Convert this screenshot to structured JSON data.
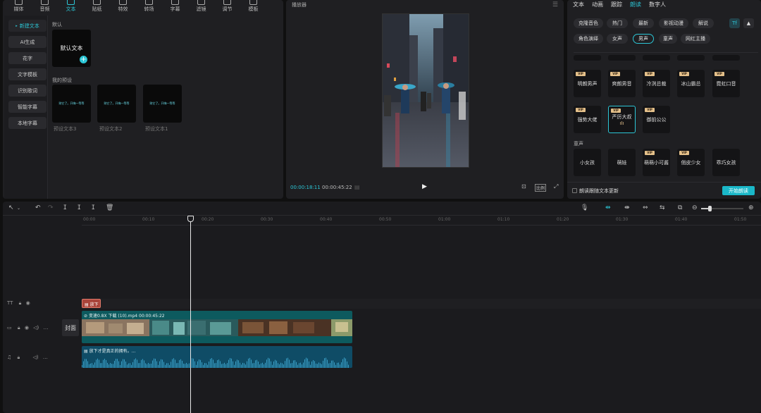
{
  "toolbar": [
    {
      "label": "媒体"
    },
    {
      "label": "音频"
    },
    {
      "label": "文本",
      "active": true
    },
    {
      "label": "贴纸"
    },
    {
      "label": "特效"
    },
    {
      "label": "转场"
    },
    {
      "label": "字幕"
    },
    {
      "label": "滤镜"
    },
    {
      "label": "调节"
    },
    {
      "label": "模板"
    }
  ],
  "sidenav": [
    {
      "label": "新建文本",
      "active": true
    },
    {
      "label": "AI生成"
    },
    {
      "label": "花字"
    },
    {
      "label": "文字模板"
    },
    {
      "label": "识别歌词"
    },
    {
      "label": "智能字幕"
    },
    {
      "label": "本地字幕"
    }
  ],
  "text_panel": {
    "default_label": "默认",
    "default_card": "默认文本",
    "add_icon": "+",
    "my_presets_label": "我的预设",
    "preset_card_text": "财它了。开嗨—等等",
    "presets": [
      "预设文本3",
      "预设文本2",
      "预设文本1"
    ]
  },
  "player": {
    "title": "播放器",
    "current_time": "00:00:18:11",
    "total_time": "00:00:45:22",
    "ratio_label": "比例"
  },
  "right": {
    "tabs": [
      "文本",
      "动画",
      "跟踪",
      "朗读",
      "数字人"
    ],
    "active_tab": "朗读",
    "chips_row1": [
      "克隆音色",
      "热门",
      "最新",
      "影视动漫",
      "解说"
    ],
    "chips_row2": [
      "角色演绎",
      "女声",
      "男声",
      "童声",
      "网红主播"
    ],
    "active_chip": "男声",
    "voices_row1": [
      "明朗男声",
      "爽朗男音",
      "冷冽总裁",
      "冰山霸总",
      "霓虹口音"
    ],
    "voices_row2": [
      "强势大佬",
      "严厉大叔",
      "御前公公"
    ],
    "child_section": "童声",
    "voices_row3": [
      "小女孩",
      "萌娃",
      "萌萌小可酱",
      "俏皮少女",
      "乖巧女孩"
    ],
    "vip_label": "VIP",
    "checkbox_label": "朗读跟随文本更新",
    "start_button": "开始朗读"
  },
  "timeline": {
    "ruler": [
      "00:00",
      "00:10",
      "00:20",
      "00:30",
      "00:40",
      "00:50",
      "01:00",
      "01:10",
      "01:20",
      "01:30",
      "01:40",
      "01:50"
    ],
    "text_clip": "放下",
    "cover_label": "封面",
    "video_clip_label": "变速0.8X  下载 (10).mp4  00:00:45:22",
    "audio_clip_label": "放下才是真正的拥有。..."
  },
  "colors": {
    "accent": "#2cc6d6",
    "vip": "#e4c08a",
    "clip_video": "#0d5a5e",
    "clip_text": "#a9443a"
  }
}
